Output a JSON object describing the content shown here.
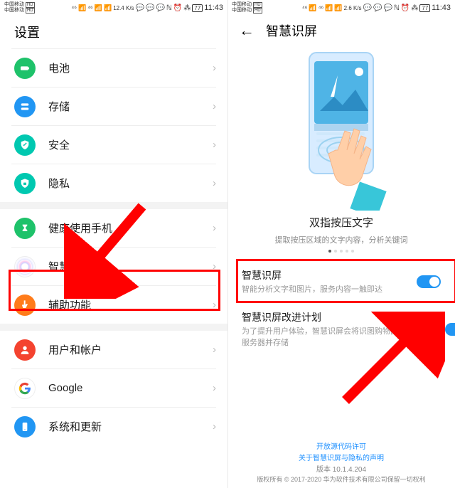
{
  "status": {
    "carrier": "中国移动",
    "speed1": "12.4 K/s",
    "speed2": "2.6 K/s",
    "time": "11:43",
    "battery": "77"
  },
  "left": {
    "title": "设置",
    "rows": {
      "battery": "电池",
      "storage": "存储",
      "security": "安全",
      "privacy": "隐私",
      "health": "健康使用手机",
      "assist": "智慧助手",
      "access": "辅助功能",
      "user": "用户和帐户",
      "google": "Google",
      "system": "系统和更新"
    }
  },
  "right": {
    "title": "智慧识屏",
    "carousel": {
      "title": "双指按压文字",
      "subtitle": "提取按压区域的文字内容，分析关键词"
    },
    "switch1": {
      "title": "智慧识屏",
      "desc": "智能分析文字和图片，服务内容一触即达"
    },
    "switch2": {
      "title": "智慧识屏改进计划",
      "desc": "为了提升用户体验，智慧识屏会将识图购物图片上传华为服务器并存储"
    },
    "footer": {
      "link1": "开放源代码许可",
      "link2": "关于智慧识屏与隐私的声明",
      "version": "版本 10.1.4.204",
      "copyright": "版权所有 © 2017-2020 华为软件技术有限公司保留一切权利"
    }
  }
}
